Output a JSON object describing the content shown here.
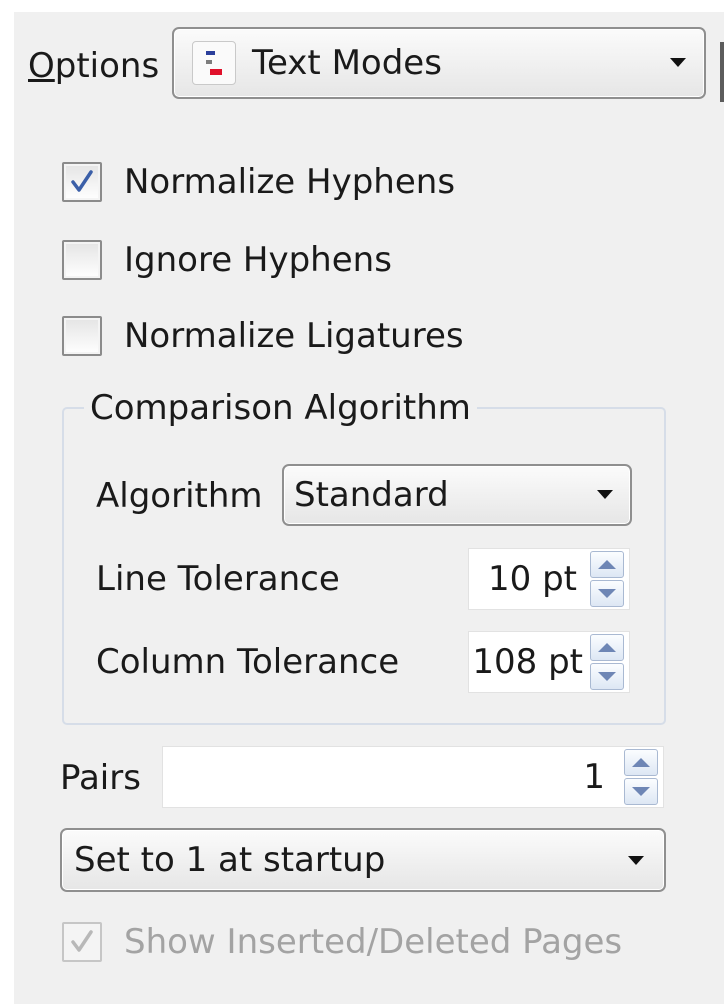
{
  "options": {
    "label_prefix": "",
    "label_accel": "O",
    "label_rest": "ptions",
    "mode_select": {
      "value": "Text Modes",
      "icon": "text-modes-icon"
    }
  },
  "checkboxes": [
    {
      "label": "Normalize Hyphens",
      "checked": true,
      "enabled": true
    },
    {
      "label": "Ignore Hyphens",
      "checked": false,
      "enabled": true
    },
    {
      "label": "Normalize Ligatures",
      "checked": false,
      "enabled": true
    }
  ],
  "comparison": {
    "title": "Comparison Algorithm",
    "algorithm": {
      "label": "Algorithm",
      "value": "Standard"
    },
    "line_tolerance": {
      "label": "Line Tolerance",
      "value": "10 pt"
    },
    "column_tolerance": {
      "label": "Column Tolerance",
      "value": "108 pt"
    }
  },
  "pairs": {
    "label": "Pairs",
    "value": "1"
  },
  "startup_select": {
    "value": "Set to 1 at startup"
  },
  "show_pages": {
    "label": "Show Inserted/Deleted Pages",
    "checked": true,
    "enabled": false
  },
  "colors": {
    "panel_bg": "#f0f0f0",
    "check": "#3b5fa8",
    "disabled": "#a3a3a3",
    "spin_arrow": "#6e86b5"
  }
}
